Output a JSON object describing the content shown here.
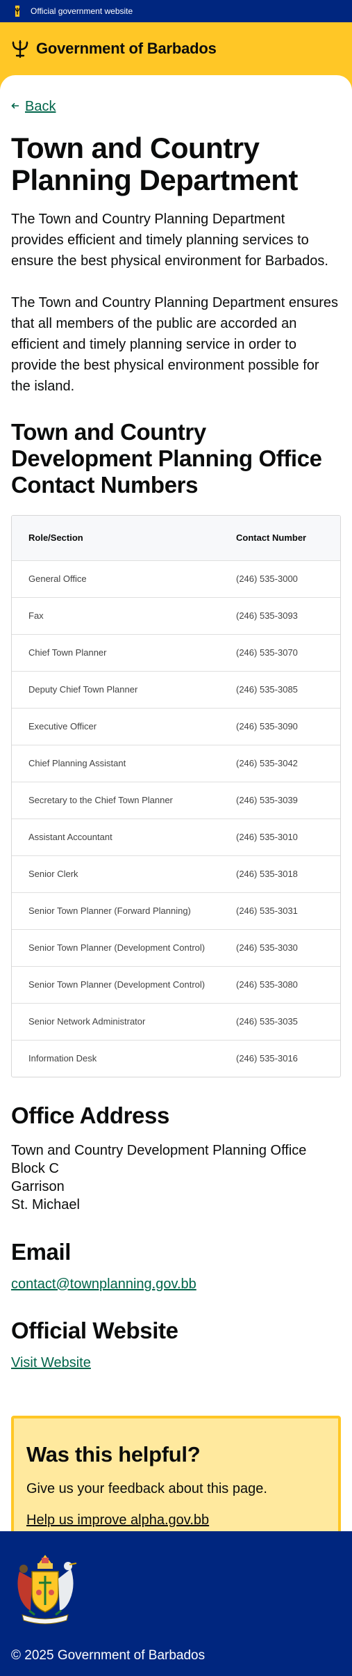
{
  "banner": {
    "text": "Official government website"
  },
  "header": {
    "title": "Government of Barbados"
  },
  "nav": {
    "back_label": "Back"
  },
  "page": {
    "title": "Town and Country Planning Department",
    "intro1": "The Town and Country Planning Department provides efficient and timely planning services to ensure the best physical environment for Barbados.",
    "intro2": "The Town and Country Planning Department ensures that all members of the public are accorded an efficient and timely planning service in order to provide the best physical environment possible for the island."
  },
  "contacts": {
    "heading": "Town and Country Development Planning Office Contact Numbers",
    "col_role": "Role/Section",
    "col_number": "Contact Number",
    "rows": [
      {
        "role": "General Office",
        "number": "(246) 535-3000"
      },
      {
        "role": "Fax",
        "number": "(246) 535-3093"
      },
      {
        "role": "Chief Town Planner",
        "number": "(246) 535-3070"
      },
      {
        "role": "Deputy Chief Town Planner",
        "number": "(246) 535-3085"
      },
      {
        "role": "Executive Officer",
        "number": "(246) 535-3090"
      },
      {
        "role": "Chief Planning Assistant",
        "number": "(246) 535-3042"
      },
      {
        "role": "Secretary to the Chief Town Planner",
        "number": "(246) 535-3039"
      },
      {
        "role": "Assistant Accountant",
        "number": "(246) 535-3010"
      },
      {
        "role": "Senior Clerk",
        "number": "(246) 535-3018"
      },
      {
        "role": "Senior Town Planner (Forward Planning)",
        "number": "(246) 535-3031"
      },
      {
        "role": "Senior Town Planner (Development Control)",
        "number": "(246) 535-3030"
      },
      {
        "role": "Senior Town Planner (Development Control)",
        "number": "(246) 535-3080"
      },
      {
        "role": "Senior Network Administrator",
        "number": "(246) 535-3035"
      },
      {
        "role": "Information Desk",
        "number": "(246) 535-3016"
      }
    ]
  },
  "address": {
    "heading": "Office Address",
    "lines": [
      "Town and Country Development Planning Office",
      "Block C",
      "Garrison",
      "St. Michael"
    ]
  },
  "email": {
    "heading": "Email",
    "address": "contact@townplanning.gov.bb"
  },
  "website": {
    "heading": "Official Website",
    "link_label": "Visit Website"
  },
  "feedback": {
    "heading": "Was this helpful?",
    "text": "Give us your feedback about this page.",
    "link_label": "Help us improve alpha.gov.bb"
  },
  "footer": {
    "copyright": "© 2025 Government of Barbados"
  },
  "icons": {
    "flag": "barbados-flag-icon",
    "trident": "trident-icon",
    "back": "arrow-left-icon",
    "coat_of_arms": "coat-of-arms-icon"
  },
  "colors": {
    "navy": "#00267f",
    "gold": "#ffc726",
    "link_green": "#00654a",
    "feedback_bg": "#ffe99e"
  }
}
